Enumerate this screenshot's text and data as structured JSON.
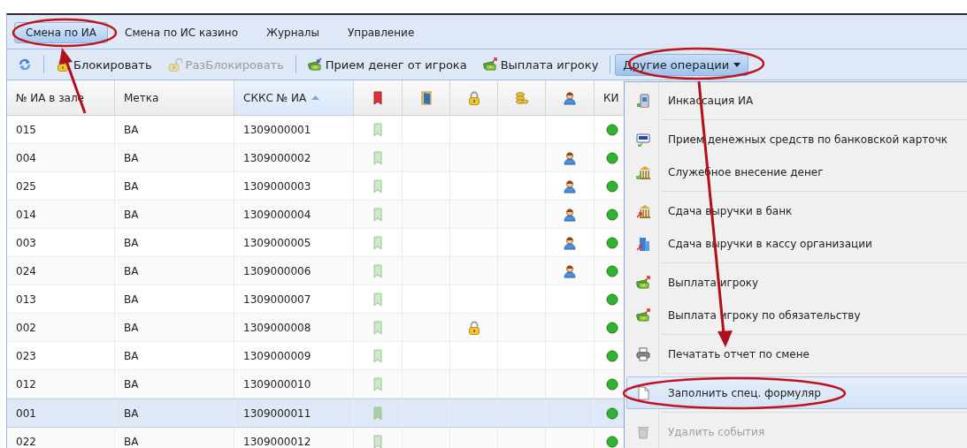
{
  "tabs": [
    {
      "label": "Смена по ИА",
      "selected": true
    },
    {
      "label": "Смена по ИС казино",
      "selected": false
    },
    {
      "label": "Журналы",
      "selected": false
    },
    {
      "label": "Управление",
      "selected": false
    }
  ],
  "toolbar": [
    {
      "kind": "refresh"
    },
    {
      "kind": "separator"
    },
    {
      "kind": "lock",
      "label": "Блокировать",
      "disabled": false
    },
    {
      "kind": "unlock",
      "label": "РазБлокировать",
      "disabled": true
    },
    {
      "kind": "separator"
    },
    {
      "kind": "cash-in",
      "label": "Прием денег от игрока",
      "disabled": false
    },
    {
      "kind": "cash-out",
      "label": "Выплата игроку",
      "disabled": false
    },
    {
      "kind": "separator"
    },
    {
      "kind": "menu",
      "label": "Другие операции",
      "expanded": true
    }
  ],
  "table": {
    "columns": [
      {
        "kind": "text",
        "label": "№ ИА в зале",
        "sorted": false
      },
      {
        "kind": "text",
        "label": "Метка",
        "sorted": false
      },
      {
        "kind": "text",
        "label": "СККС № ИА",
        "sorted": true
      },
      {
        "kind": "bookmark",
        "sorted": false
      },
      {
        "kind": "door",
        "sorted": false
      },
      {
        "kind": "lock",
        "sorted": false
      },
      {
        "kind": "coins",
        "sorted": false
      },
      {
        "kind": "person",
        "sorted": false
      },
      {
        "kind": "text",
        "label": "КИ",
        "sorted": false
      }
    ],
    "rows": [
      {
        "number": "015",
        "mark": "BA",
        "skks": "1309000001",
        "locked": false,
        "player": false,
        "selected": false
      },
      {
        "number": "004",
        "mark": "BA",
        "skks": "1309000002",
        "locked": false,
        "player": true,
        "selected": false
      },
      {
        "number": "025",
        "mark": "BA",
        "skks": "1309000003",
        "locked": false,
        "player": true,
        "selected": false
      },
      {
        "number": "014",
        "mark": "BA",
        "skks": "1309000004",
        "locked": false,
        "player": true,
        "selected": false
      },
      {
        "number": "003",
        "mark": "BA",
        "skks": "1309000005",
        "locked": false,
        "player": true,
        "selected": false
      },
      {
        "number": "024",
        "mark": "BA",
        "skks": "1309000006",
        "locked": false,
        "player": true,
        "selected": false
      },
      {
        "number": "013",
        "mark": "BA",
        "skks": "1309000007",
        "locked": false,
        "player": false,
        "selected": false
      },
      {
        "number": "002",
        "mark": "BA",
        "skks": "1309000008",
        "locked": true,
        "player": false,
        "selected": false
      },
      {
        "number": "023",
        "mark": "BA",
        "skks": "1309000009",
        "locked": false,
        "player": false,
        "selected": false
      },
      {
        "number": "012",
        "mark": "BA",
        "skks": "1309000010",
        "locked": false,
        "player": false,
        "selected": false
      },
      {
        "number": "001",
        "mark": "BA",
        "skks": "1309000011",
        "locked": false,
        "player": false,
        "selected": true
      },
      {
        "number": "022",
        "mark": "BA",
        "skks": "1309000012",
        "locked": false,
        "player": false,
        "selected": false
      }
    ]
  },
  "menu": {
    "groups": [
      [
        {
          "kind": "terminal",
          "label": "Инкассация ИА",
          "selected": false,
          "disabled": false
        }
      ],
      [
        {
          "kind": "card",
          "label": "Прием денежных средств по банковской карточк",
          "selected": false,
          "disabled": false
        },
        {
          "kind": "bank-in",
          "label": "Служебное внесение денег",
          "selected": false,
          "disabled": false
        }
      ],
      [
        {
          "kind": "bank-out",
          "label": "Сдача выручки в банк",
          "selected": false,
          "disabled": false
        },
        {
          "kind": "building",
          "label": "Сдача выручки в кассу организации",
          "selected": false,
          "disabled": false
        }
      ],
      [
        {
          "kind": "cash-out",
          "label": "Выплата игроку",
          "selected": false,
          "disabled": false
        },
        {
          "kind": "cash-out",
          "label": "Выплата игроку по обязательству",
          "selected": false,
          "disabled": false
        }
      ],
      [
        {
          "kind": "printer",
          "label": "Печатать отчет по смене",
          "selected": false,
          "disabled": false
        }
      ],
      [
        {
          "kind": "document",
          "label": "Заполнить спец. формуляр",
          "selected": true,
          "disabled": false
        }
      ],
      [
        {
          "kind": "trash",
          "label": "Удалить события",
          "selected": false,
          "disabled": true
        }
      ]
    ]
  }
}
